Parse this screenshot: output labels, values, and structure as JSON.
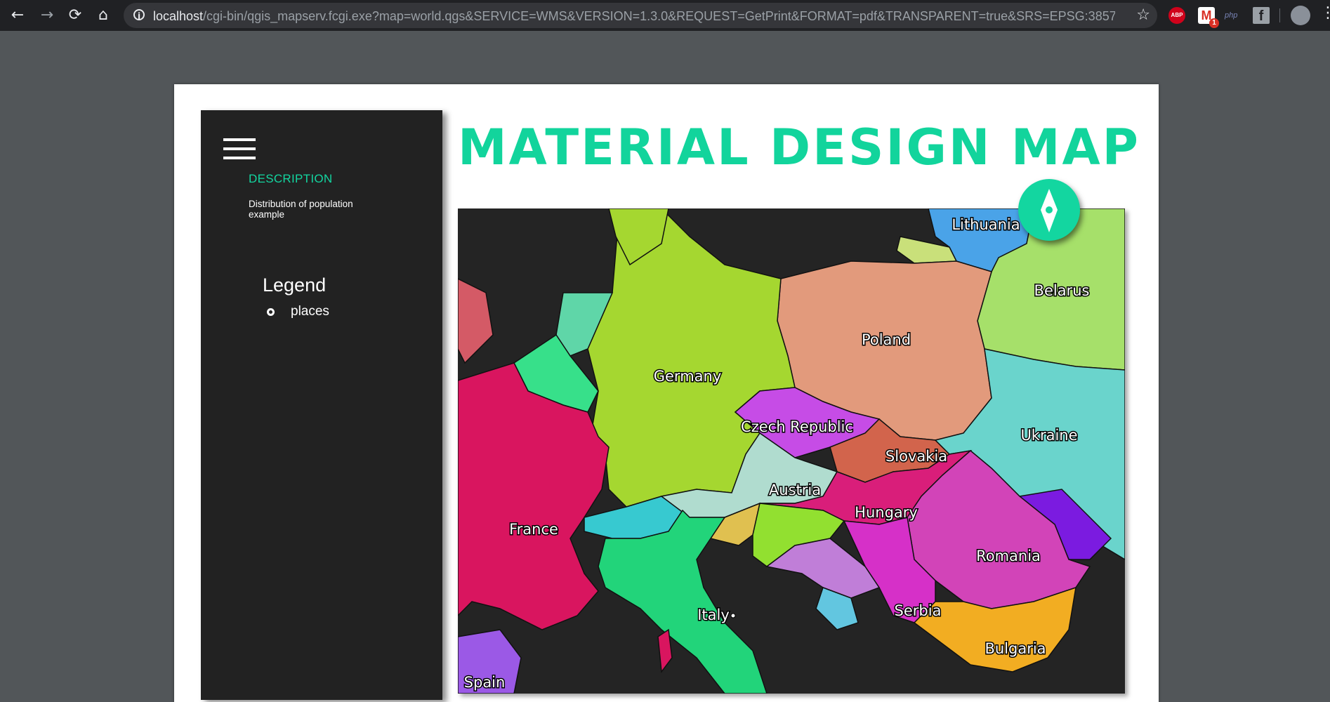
{
  "browser": {
    "url_host": "localhost",
    "url_path": "/cgi-bin/qgis_mapserv.fcgi.exe?map=world.qgs&SERVICE=WMS&VERSION=1.3.0&REQUEST=GetPrint&FORMAT=pdf&TRANSPARENT=true&SRS=EPSG:3857&DPI=300...",
    "back_icon": "←",
    "forward_icon": "→",
    "reload_icon": "⟳",
    "home_icon": "⌂",
    "info_icon": "i",
    "star_icon": "☆",
    "menu_icon": "⋮",
    "extensions": {
      "abp": "ABP",
      "gmail": "M",
      "gmail_count": "1",
      "php": "php",
      "facebook": "f"
    }
  },
  "drawer": {
    "description_title": "DESCRIPTION",
    "description_text": "Distribution of population example",
    "legend_title": "Legend",
    "legend_items": [
      {
        "label": "places"
      }
    ]
  },
  "map": {
    "title": "MATERIAL DESIGN MAP",
    "countries": [
      "Lithuania",
      "Belarus",
      "Poland",
      "Germany",
      "Czech Republic",
      "Slovakia",
      "Ukraine",
      "Austria",
      "Hungary",
      "France",
      "Romania",
      "Italy",
      "Serbia",
      "Bulgaria",
      "Spain"
    ]
  },
  "colors": {
    "accent": "#13d6a0",
    "page_background": "#525659",
    "drawer_background": "#222222"
  }
}
